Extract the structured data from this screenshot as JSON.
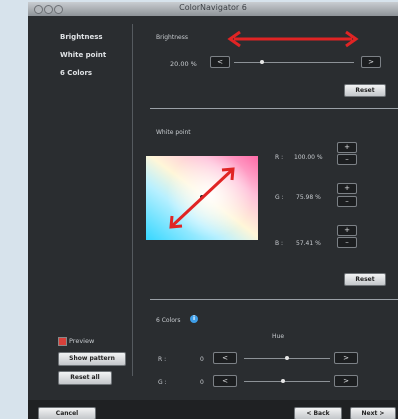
{
  "window": {
    "title": "ColorNavigator 6"
  },
  "sidebar": {
    "items": [
      {
        "label": "Brightness"
      },
      {
        "label": "White point"
      },
      {
        "label": "6 Colors"
      }
    ],
    "preview_label": "Preview",
    "show_pattern_label": "Show pattern",
    "reset_all_label": "Reset all"
  },
  "brightness": {
    "heading": "Brightness",
    "value": "20.00 %",
    "decrease_label": "<",
    "increase_label": ">",
    "reset_label": "Reset"
  },
  "white_point": {
    "heading": "White point",
    "r_label": "R :",
    "r_value": "100.00 %",
    "g_label": "G :",
    "g_value": "75.98 %",
    "b_label": "B :",
    "b_value": "57.41 %",
    "plus": "+",
    "minus": "–",
    "reset_label": "Reset"
  },
  "six_colors": {
    "heading": "6 Colors",
    "hue_label": "Hue",
    "rows": [
      {
        "label": "R :",
        "value": "0",
        "dec": "<",
        "inc": ">"
      },
      {
        "label": "G :",
        "value": "0",
        "dec": "<",
        "inc": ">"
      }
    ]
  },
  "footer": {
    "cancel_label": "Cancel",
    "back_label": "< Back",
    "next_label": "Next >"
  },
  "colors": {
    "window_bg": "#2a2d30",
    "annotation_red": "#e02424",
    "checkbox_red": "#d8403a"
  }
}
